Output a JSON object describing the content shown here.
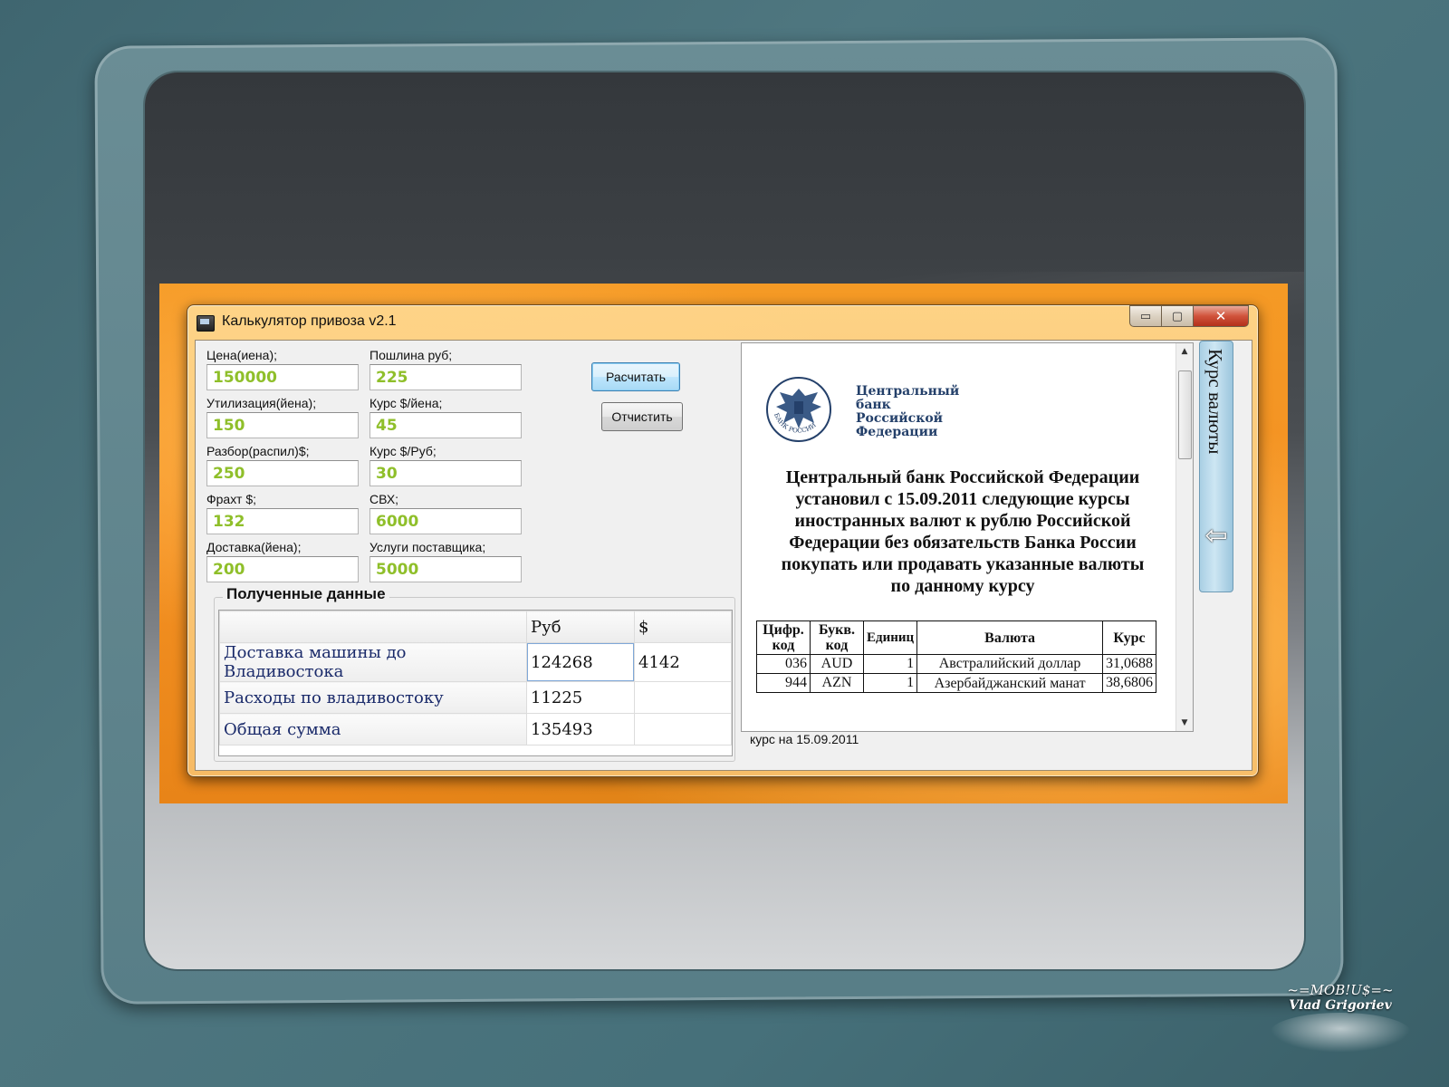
{
  "window": {
    "title": "Калькулятор привоза v2.1",
    "min_glyph": "▭",
    "max_glyph": "▢",
    "close_glyph": "✕"
  },
  "form": {
    "left": [
      {
        "label": "Цена(иена);",
        "value": "150000"
      },
      {
        "label": "Утилизация(йена);",
        "value": "150"
      },
      {
        "label": "Разбор(распил)$;",
        "value": "250"
      },
      {
        "label": "Фрахт $;",
        "value": "132"
      },
      {
        "label": "Доставка(йена);",
        "value": "200"
      }
    ],
    "right": [
      {
        "label": "Пошлина руб;",
        "value": "225"
      },
      {
        "label": "Курс $/йена;",
        "value": "45"
      },
      {
        "label": "Курс $/Руб;",
        "value": "30"
      },
      {
        "label": "СВХ;",
        "value": "6000"
      },
      {
        "label": "Услуги поставщика;",
        "value": "5000"
      }
    ],
    "calculate_label": "Расчитать",
    "clear_label": "Отчистить"
  },
  "results": {
    "title": "Полученные данные",
    "columns": [
      "",
      "Руб",
      "$"
    ],
    "rows": [
      [
        "Доставка машины до Владивостока",
        "124268",
        "4142"
      ],
      [
        "Расходы по владивостоку",
        "11225",
        ""
      ],
      [
        "Общая сумма",
        "135493",
        ""
      ]
    ]
  },
  "browser": {
    "emblem_text": "БАНК РОССИИ",
    "bank_name": [
      "Центральный",
      "банк",
      "Российской",
      "Федерации"
    ],
    "decree": [
      "Центральный банк Российской Федерации",
      "установил с 15.09.2011 следующие курсы",
      "иностранных валют к рублю Российской",
      "Федерации без обязательств Банка России",
      "покупать или продавать указанные валюты",
      "по данному курсу"
    ],
    "table_headers": [
      "Цифр. код",
      "Букв. код",
      "Единиц",
      "Валюта",
      "Курс"
    ],
    "table_rows": [
      [
        "036",
        "AUD",
        "1",
        "Австралийский доллар",
        "31,0688"
      ],
      [
        "944",
        "AZN",
        "1",
        "Азербайджанский манат",
        "38,6806"
      ]
    ],
    "status": "курс на 15.09.2011"
  },
  "side_tab": {
    "label": "Курс валюты",
    "arrow": "⇦"
  },
  "watermark": {
    "line1": "~=MOB!U$=~",
    "line2": "Vlad Grigoriev"
  },
  "colors": {
    "value_text": "#8fbf2a",
    "desktop": "#f39022",
    "grid_row_header": "#1a2a6a"
  }
}
